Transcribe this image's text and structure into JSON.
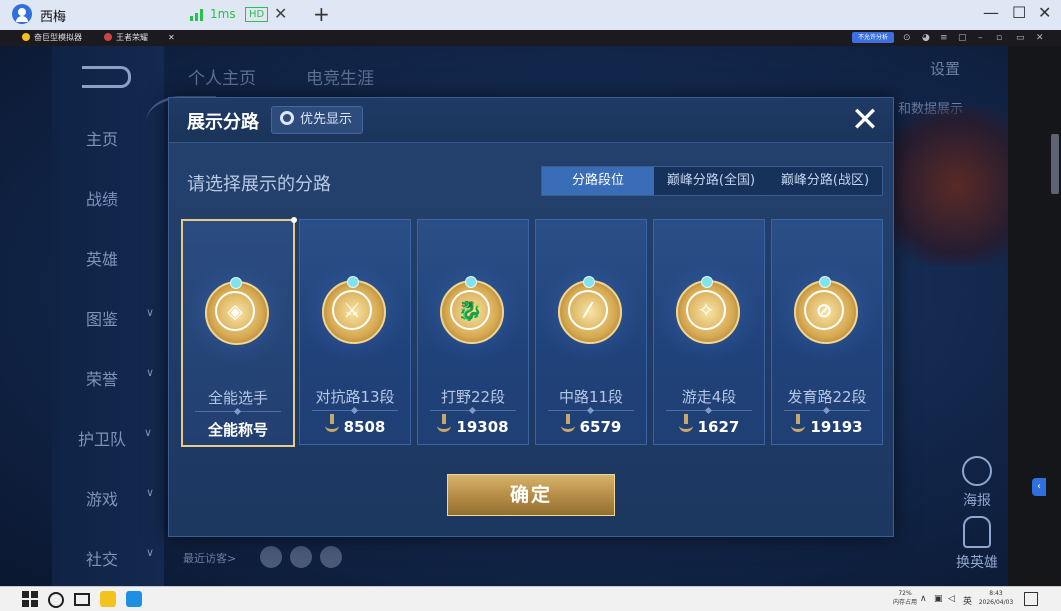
{
  "browser": {
    "tab_title": "西梅",
    "ping": "1ms",
    "hd_label": "HD",
    "new_tab": "+"
  },
  "emulator_bar": {
    "tab1": "奋巨型模拟器",
    "tab2": "王者荣耀",
    "badge": "不允许分析"
  },
  "game": {
    "top_tabs": [
      "个人主页",
      "电竞生涯"
    ],
    "nav_items": [
      {
        "label": "主页",
        "chevron": false
      },
      {
        "label": "战绩",
        "chevron": false
      },
      {
        "label": "英雄",
        "chevron": false
      },
      {
        "label": "图鉴",
        "chevron": true
      },
      {
        "label": "荣誉",
        "chevron": true
      },
      {
        "label": "护卫队",
        "chevron": true
      },
      {
        "label": "游戏",
        "chevron": true
      },
      {
        "label": "社交",
        "chevron": true
      }
    ],
    "settings": "设置",
    "data_show": "和数据展示",
    "poster": "海报",
    "swap_hero": "换英雄",
    "recent_visitors": "最近访客>"
  },
  "dialog": {
    "title": "展示分路",
    "priority_button": "优先显示",
    "close": "✕",
    "subtitle": "请选择展示的分路",
    "tabs": [
      {
        "label": "分路段位",
        "active": true
      },
      {
        "label": "巅峰分路(全国)",
        "active": false
      },
      {
        "label": "巅峰分路(战区)",
        "active": false
      }
    ],
    "cards": [
      {
        "role": "全能选手",
        "score": "全能称号",
        "selected": true,
        "glyph": "◈",
        "icon": "all-round-emblem-icon",
        "show_wing": false
      },
      {
        "role": "对抗路13段",
        "score": "8508",
        "selected": false,
        "glyph": "⚔",
        "icon": "clash-lane-emblem-icon",
        "show_wing": true
      },
      {
        "role": "打野22段",
        "score": "19308",
        "selected": false,
        "glyph": "🐉",
        "icon": "jungle-emblem-icon",
        "show_wing": true
      },
      {
        "role": "中路11段",
        "score": "6579",
        "selected": false,
        "glyph": "⁄",
        "icon": "mid-lane-emblem-icon",
        "show_wing": true
      },
      {
        "role": "游走4段",
        "score": "1627",
        "selected": false,
        "glyph": "✧",
        "icon": "roam-emblem-icon",
        "show_wing": true
      },
      {
        "role": "发育路22段",
        "score": "19193",
        "selected": false,
        "glyph": "⊘",
        "icon": "farm-lane-emblem-icon",
        "show_wing": true
      }
    ],
    "confirm": "确定"
  },
  "taskbar": {
    "tray_cpu": "72%",
    "tray_mem": "内存占用",
    "tray_lang": "英",
    "time": "8:43",
    "date": "2026/04/03"
  }
}
